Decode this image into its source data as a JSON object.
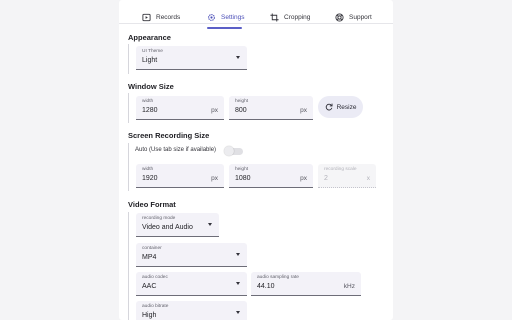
{
  "tabs": [
    {
      "label": "Records",
      "icon": "records-icon"
    },
    {
      "label": "Settings",
      "icon": "settings-gear-icon",
      "active": true
    },
    {
      "label": "Cropping",
      "icon": "crop-icon"
    },
    {
      "label": "Support",
      "icon": "support-icon"
    }
  ],
  "colors": {
    "accent": "#5b5fc7",
    "field_bg": "#f3f2f8"
  },
  "appearance": {
    "heading": "Appearance",
    "ui_theme": {
      "label": "UI Theme",
      "value": "Light"
    }
  },
  "window_size": {
    "heading": "Window Size",
    "width": {
      "label": "width",
      "value": "1280",
      "suffix": "px"
    },
    "height": {
      "label": "height",
      "value": "800",
      "suffix": "px"
    },
    "resize_label": "Resize"
  },
  "screen_recording": {
    "heading": "Screen Recording Size",
    "auto_label": "Auto (Use tab size if available)",
    "auto_enabled": false,
    "width": {
      "label": "width",
      "value": "1920",
      "suffix": "px"
    },
    "height": {
      "label": "height",
      "value": "1080",
      "suffix": "px"
    },
    "scale": {
      "label": "recording scale",
      "value": "2",
      "suffix": "x"
    }
  },
  "video_format": {
    "heading": "Video Format",
    "recording_mode": {
      "label": "recording mode",
      "value": "Video and Audio"
    },
    "container": {
      "label": "container",
      "value": "MP4"
    },
    "audio_codec": {
      "label": "audio codec",
      "value": "AAC"
    },
    "sampling_rate": {
      "label": "audio sampling rate",
      "value": "44.10",
      "suffix": "kHz"
    },
    "audio_bitrate": {
      "label": "audio bitrate",
      "value": "High"
    }
  }
}
